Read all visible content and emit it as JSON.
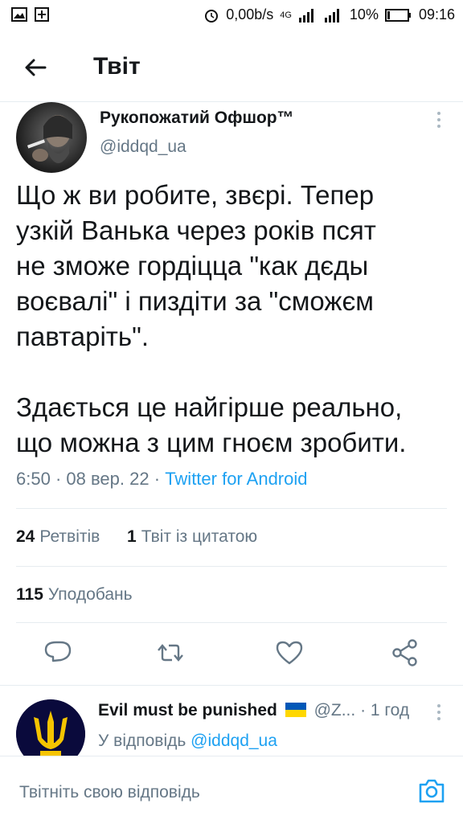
{
  "status_bar": {
    "speed": "0,00b/s",
    "network": "4G",
    "battery": "10%",
    "time": "09:16"
  },
  "header": {
    "title": "Твіт",
    "back_icon": "arrow-left-icon"
  },
  "tweet": {
    "author_name": "Рукопожатий Офшор™",
    "author_handle": "@iddqd_ua",
    "text": "Що ж ви робите, звєрі. Тепер\nузкій Ванька через років псят\nне зможе гордіцца \"как дєды\nвоєвалі\" і пиздіти за \"сможєм\nпавтаріть\".\n\nЗдається це найгірше реально,\nщо можна з цим гноєм зробити.",
    "time": "6:50",
    "date": "08 вер. 22",
    "source": "Twitter for Android",
    "retweets_count": "24",
    "retweets_label": "Ретвітів",
    "quotes_count": "1",
    "quotes_label": "Твіт із цитатою",
    "likes_count": "115",
    "likes_label": "Уподобань"
  },
  "actions": [
    "reply-icon",
    "retweet-icon",
    "like-icon",
    "share-icon"
  ],
  "reply": {
    "author_name": "Evil must be punished",
    "author_handle": "@Z...",
    "time": "1 год",
    "replying_to_label": "У відповідь",
    "replying_to_handle": "@iddqd_ua"
  },
  "composer": {
    "placeholder": "Твітніть свою відповідь",
    "camera_icon": "camera-icon"
  },
  "colors": {
    "accent": "#1da1f2",
    "text": "#14171a",
    "muted": "#657786",
    "divider": "#e6ecf0",
    "flag_blue": "#0057b7",
    "flag_yellow": "#ffd700"
  }
}
